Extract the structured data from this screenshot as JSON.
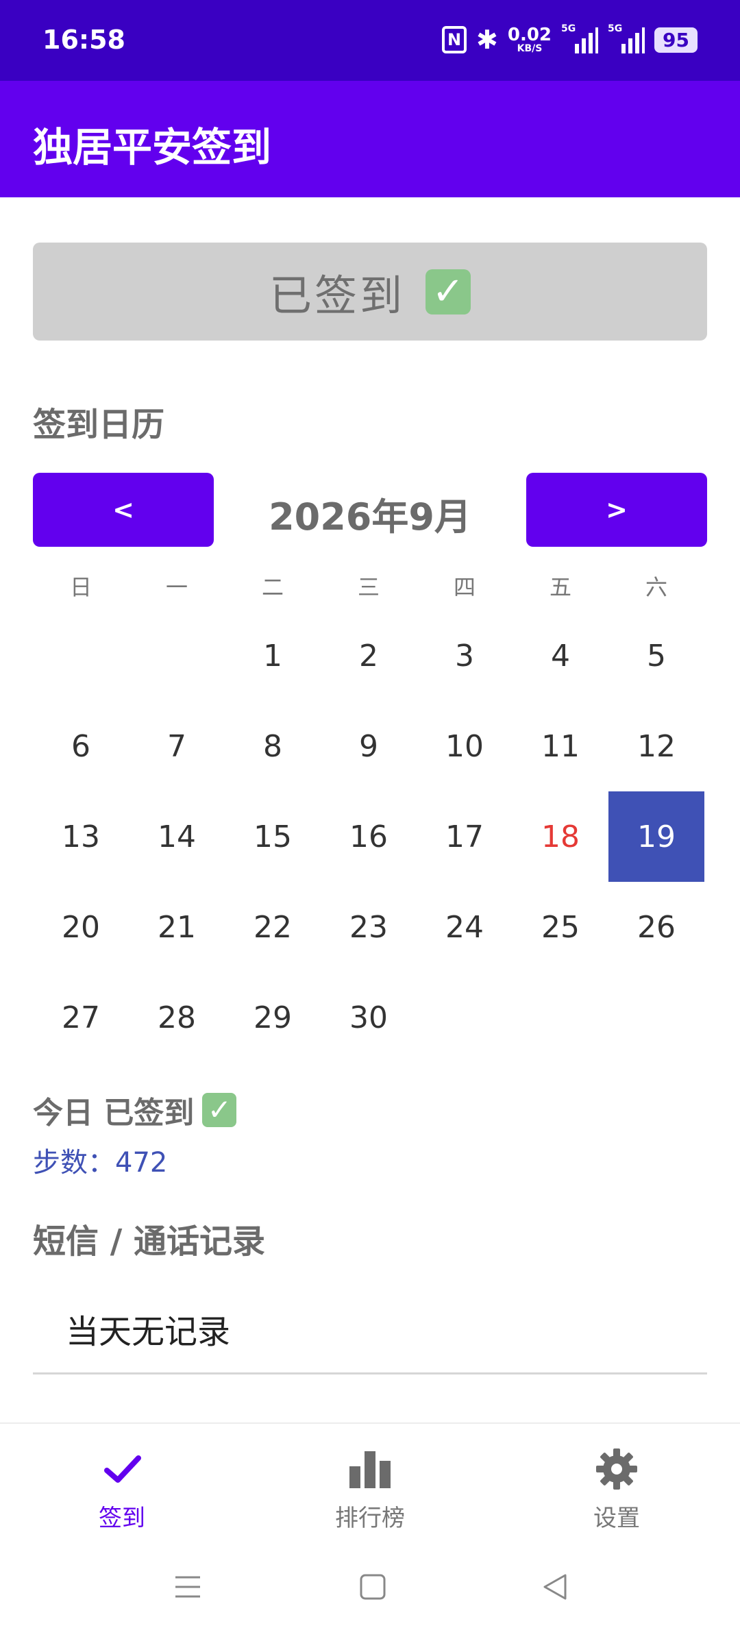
{
  "status_bar": {
    "time": "16:58",
    "nfc": "N",
    "bluetooth": "✱",
    "speed_value": "0.02",
    "speed_unit": "KB/S",
    "signal_tag_1": "5G",
    "signal_tag_2": "5G",
    "battery": "95"
  },
  "app_bar": {
    "title": "独居平安签到"
  },
  "checkin": {
    "label": "已签到",
    "icon": "check-mark-button-icon"
  },
  "calendar": {
    "section_title": "签到日历",
    "prev_label": "<",
    "next_label": ">",
    "month_label": "2026年9月",
    "weekdays": [
      "日",
      "一",
      "二",
      "三",
      "四",
      "五",
      "六"
    ],
    "days": [
      "1",
      "2",
      "3",
      "4",
      "5",
      "6",
      "7",
      "8",
      "9",
      "10",
      "11",
      "12",
      "13",
      "14",
      "15",
      "16",
      "17",
      "18",
      "19",
      "20",
      "21",
      "22",
      "23",
      "24",
      "25",
      "26",
      "27",
      "28",
      "29",
      "30"
    ],
    "highlight_red_day": "18",
    "selected_day": "19",
    "red_color": "#e53935",
    "selected_color": "#3f51b5"
  },
  "today": {
    "status_label": "今日 已签到",
    "steps_label": "步数：472"
  },
  "records": {
    "section_title": "短信 / 通话记录",
    "empty_text": "当天无记录"
  },
  "bottom_nav": {
    "items": [
      {
        "label": "签到",
        "icon": "check-icon",
        "active": true
      },
      {
        "label": "排行榜",
        "icon": "bar-chart-icon",
        "active": false
      },
      {
        "label": "设置",
        "icon": "gear-icon",
        "active": false
      }
    ]
  },
  "theme": {
    "primary": "#6200ee",
    "status_bar": "#3a00c2",
    "accent": "#3f51b5"
  }
}
